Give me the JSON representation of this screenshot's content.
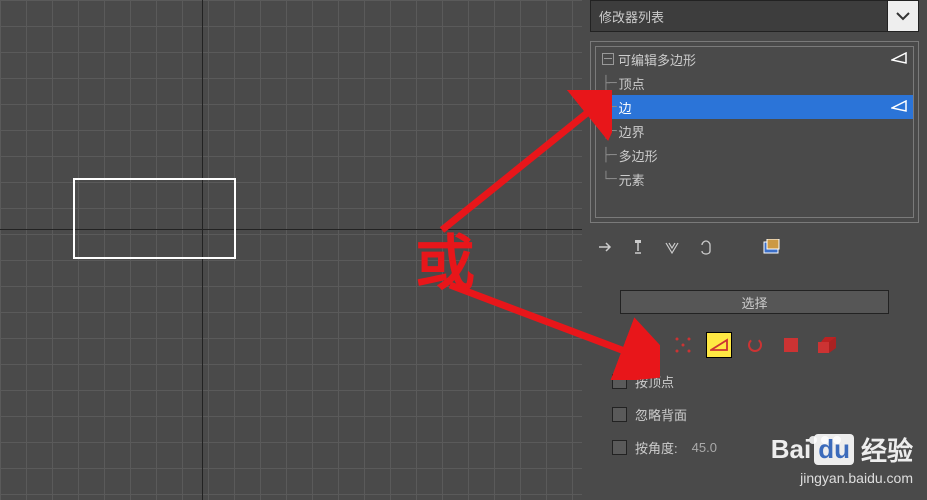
{
  "modifier_dropdown": "修改器列表",
  "stack": {
    "root": "可编辑多边形",
    "sub": [
      "顶点",
      "边",
      "边界",
      "多边形",
      "元素"
    ],
    "selected_index": 1
  },
  "selection": {
    "header": "选择",
    "by_vertex": "按顶点",
    "ignore_backfacing": "忽略背面",
    "by_angle": "按角度:",
    "angle_value": "45.0"
  },
  "annotation": {
    "or": "或"
  },
  "watermark": {
    "brand_a": "Bai",
    "brand_b": "du",
    "brand_c": "经验",
    "url": "jingyan.baidu.com"
  }
}
